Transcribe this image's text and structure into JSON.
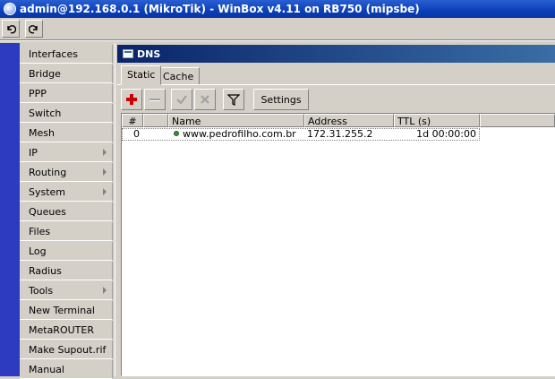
{
  "window": {
    "title": "admin@192.168.0.1 (MikroTik) - WinBox v4.11 on RB750 (mipsbe)"
  },
  "toolbar": {
    "undo": "undo-icon",
    "redo": "redo-icon"
  },
  "menu": {
    "items": [
      {
        "label": "Interfaces",
        "submenu": false
      },
      {
        "label": "Bridge",
        "submenu": false
      },
      {
        "label": "PPP",
        "submenu": false
      },
      {
        "label": "Switch",
        "submenu": false
      },
      {
        "label": "Mesh",
        "submenu": false
      },
      {
        "label": "IP",
        "submenu": true
      },
      {
        "label": "Routing",
        "submenu": true
      },
      {
        "label": "System",
        "submenu": true
      },
      {
        "label": "Queues",
        "submenu": false
      },
      {
        "label": "Files",
        "submenu": false
      },
      {
        "label": "Log",
        "submenu": false
      },
      {
        "label": "Radius",
        "submenu": false
      },
      {
        "label": "Tools",
        "submenu": true
      },
      {
        "label": "New Terminal",
        "submenu": false
      },
      {
        "label": "MetaROUTER",
        "submenu": false
      },
      {
        "label": "Make Supout.rif",
        "submenu": false
      },
      {
        "label": "Manual",
        "submenu": false
      }
    ]
  },
  "dns": {
    "title": "DNS",
    "tabs": [
      {
        "label": "Static",
        "active": true
      },
      {
        "label": "Cache",
        "active": false
      }
    ],
    "buttons": {
      "add": "plus-icon",
      "remove": "minus-icon",
      "enable": "check-icon",
      "disable": "x-icon",
      "filter": "filter-icon",
      "settings_label": "Settings"
    },
    "columns": [
      "#",
      "",
      "Name",
      "Address",
      "TTL (s)"
    ],
    "rows": [
      {
        "num": "0",
        "name": "www.pedrofilho.com.br",
        "address": "172.31.255.2",
        "ttl": "1d 00:00:00"
      }
    ]
  },
  "colors": {
    "titlebar": "#0a3fb8",
    "left_strip": "#2d3bc0",
    "panel": "#d4d0c8",
    "add_icon": "#cc0000",
    "status_dot": "#3c8c3c"
  }
}
